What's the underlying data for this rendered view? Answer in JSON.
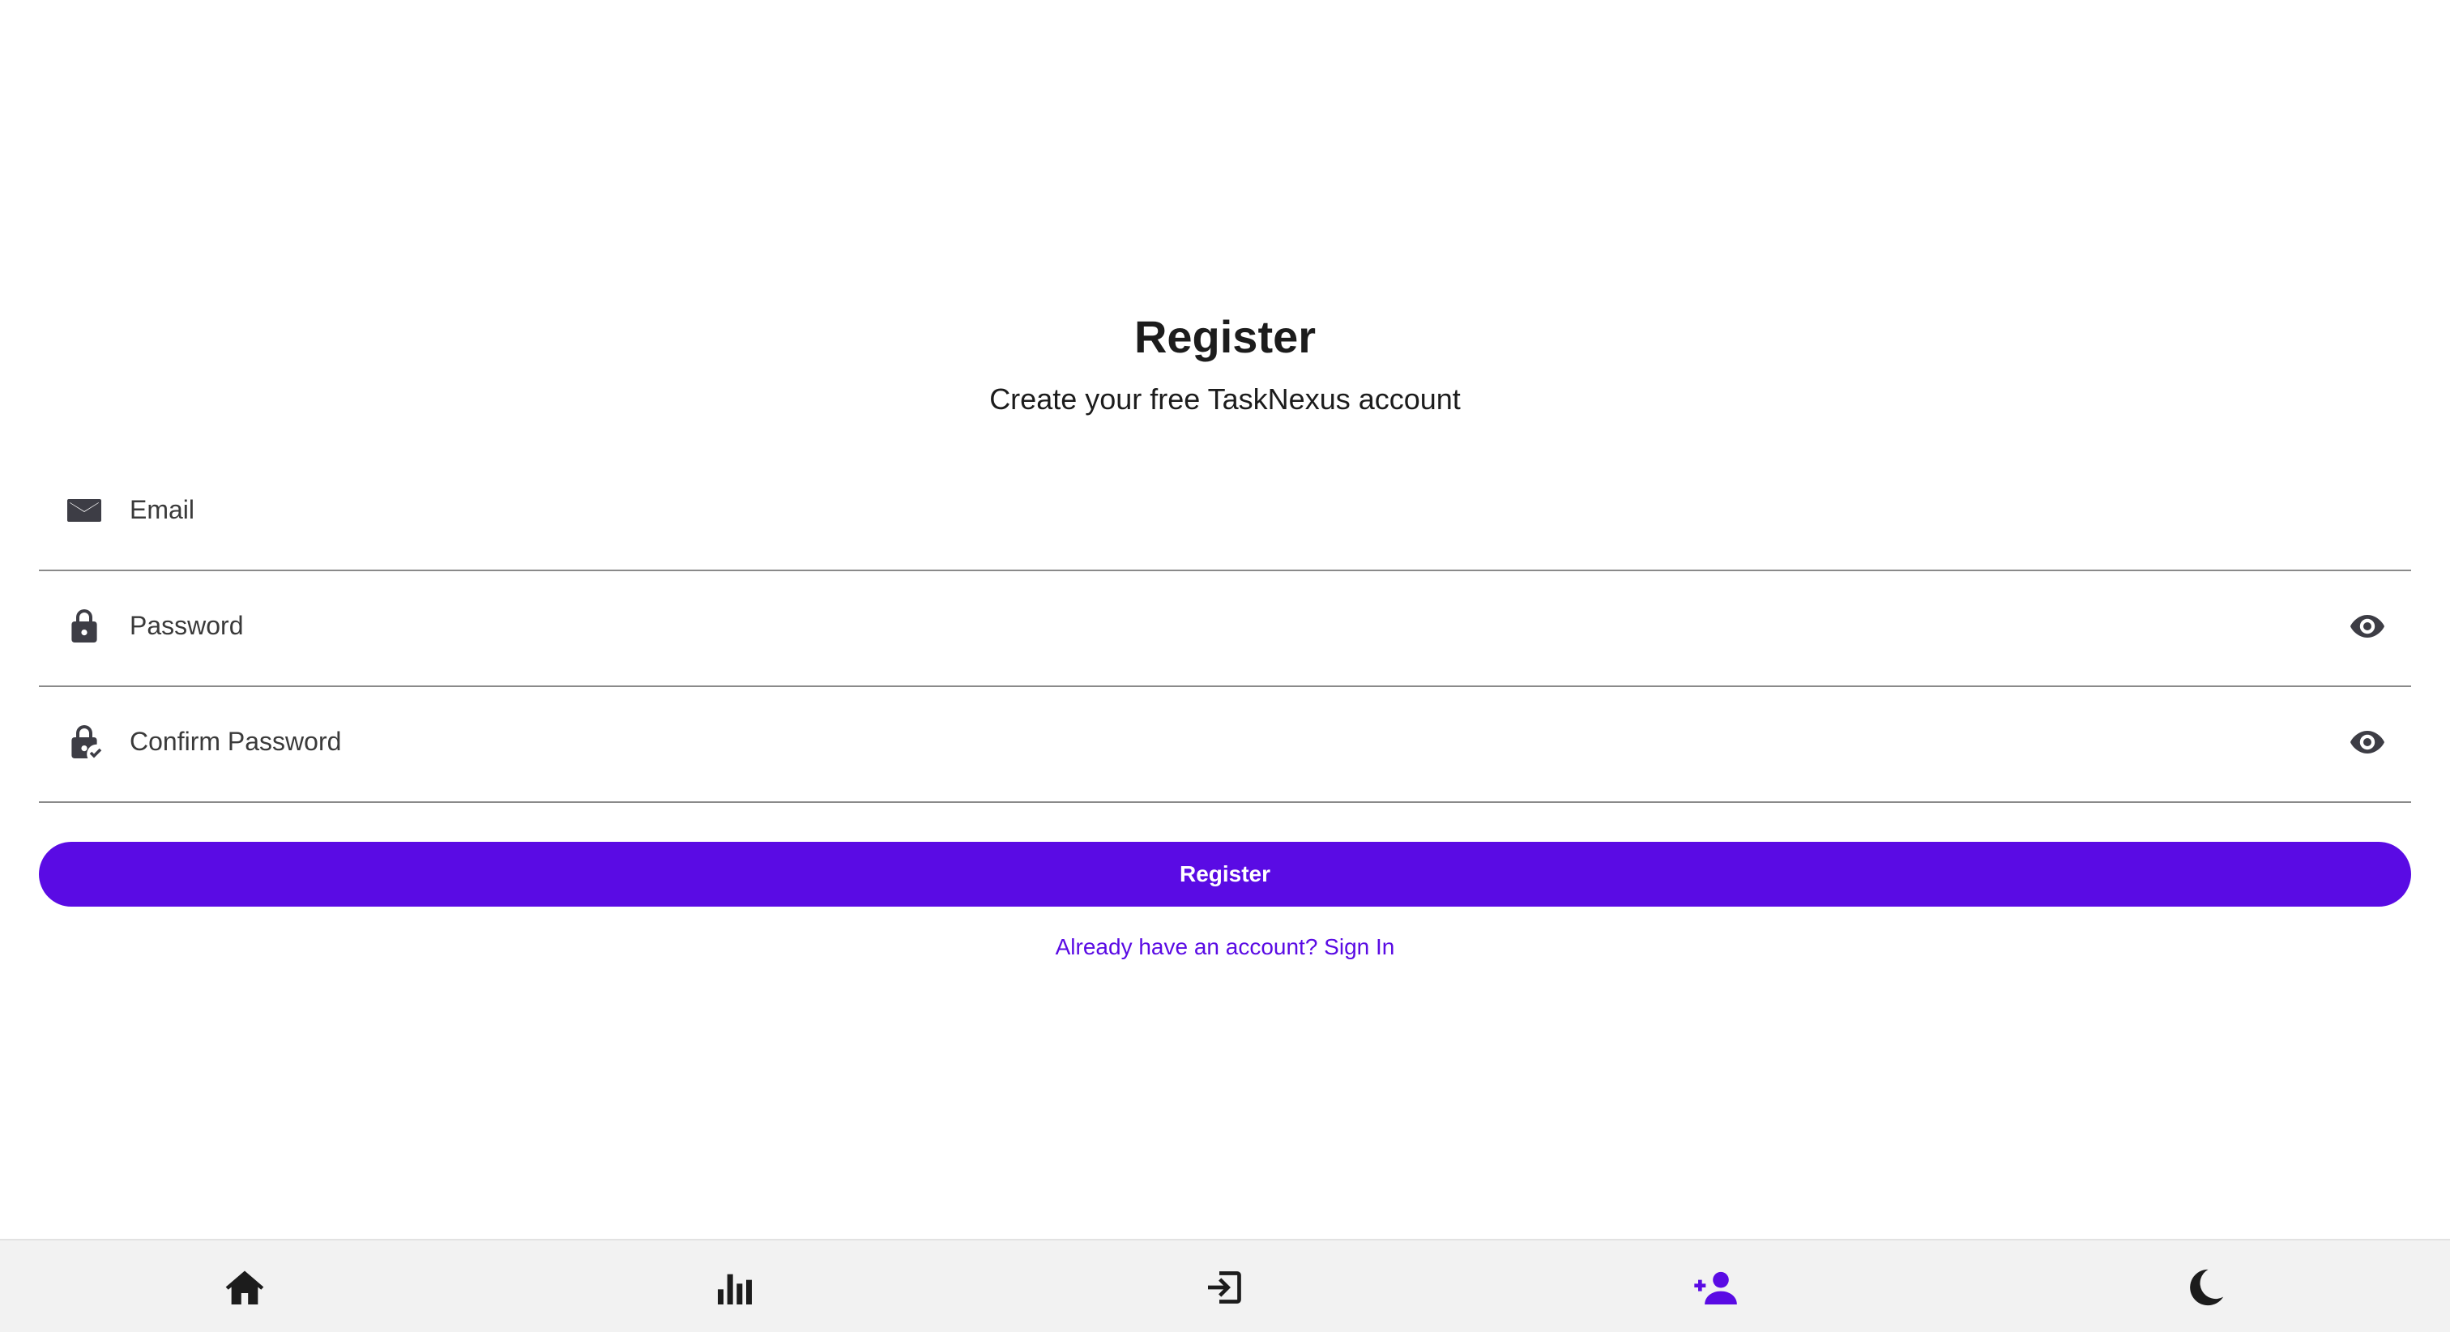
{
  "header": {
    "title": "Register",
    "subtitle": "Create your free TaskNexus account"
  },
  "form": {
    "email": {
      "placeholder": "Email",
      "value": "",
      "icon": "envelope-icon"
    },
    "password": {
      "placeholder": "Password",
      "value": "",
      "icon": "lock-icon",
      "toggle_icon": "eye-icon"
    },
    "confirm_password": {
      "placeholder": "Confirm Password",
      "value": "",
      "icon": "lock-check-icon",
      "toggle_icon": "eye-icon"
    },
    "submit_label": "Register",
    "signin_link": "Already have an account? Sign In"
  },
  "bottom_nav": {
    "items": [
      {
        "icon": "home-icon",
        "active": false
      },
      {
        "icon": "bar-chart-icon",
        "active": false
      },
      {
        "icon": "sign-in-icon",
        "active": false
      },
      {
        "icon": "user-plus-icon",
        "active": true
      },
      {
        "icon": "moon-icon",
        "active": false
      }
    ]
  },
  "colors": {
    "accent": "#5a0be4",
    "text": "#1c1c1c",
    "icon": "#3d3d45",
    "nav_background": "#f2f2f2",
    "divider": "#8a8a8a"
  }
}
